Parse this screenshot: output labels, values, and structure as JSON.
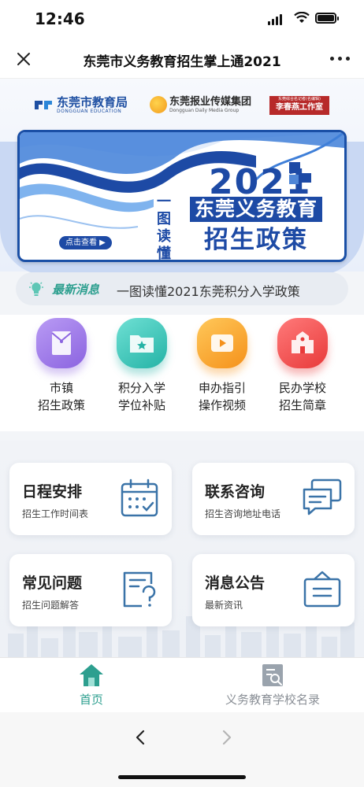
{
  "status_bar": {
    "time": "12:46"
  },
  "nav": {
    "title": "东莞市义务教育招生掌上通2021"
  },
  "logos": {
    "edu_bureau": "东莞市教育局",
    "edu_bureau_en": "DONGGUAN EDUCATION",
    "media_group": "东莞报业传媒集团",
    "media_group_en": "Dongguan Daily Media Group",
    "studio_top": "东莞综合名记者(名编辑)",
    "studio_name": "李春燕工作室"
  },
  "banner": {
    "year": "2021",
    "line1": "东莞义务教育",
    "line2": "招生政策",
    "vertical": "一图读懂",
    "button": "点击查看"
  },
  "ticker": {
    "label": "最新消息",
    "text": "一图读懂2021东莞积分入学政策"
  },
  "quick_links": [
    {
      "line1": "市镇",
      "line2": "招生政策",
      "icon": "envelope-icon",
      "color": "#9b73e6"
    },
    {
      "line1": "积分入学",
      "line2": "学位补贴",
      "icon": "folder-star-icon",
      "color": "#33c4b7"
    },
    {
      "line1": "申办指引",
      "line2": "操作视频",
      "icon": "play-video-icon",
      "color": "#f7a21b"
    },
    {
      "line1": "民办学校",
      "line2": "招生简章",
      "icon": "school-icon",
      "color": "#f04b4b"
    }
  ],
  "cards": [
    {
      "title": "日程安排",
      "subtitle": "招生工作时间表",
      "icon": "calendar-icon"
    },
    {
      "title": "联系咨询",
      "subtitle": "招生咨询地址电话",
      "icon": "chat-icon"
    },
    {
      "title": "常见问题",
      "subtitle": "招生问题解答",
      "icon": "faq-icon"
    },
    {
      "title": "消息公告",
      "subtitle": "最新资讯",
      "icon": "notice-board-icon"
    }
  ],
  "tabs": [
    {
      "label": "首页",
      "active": true,
      "icon": "home-icon"
    },
    {
      "label": "义务教育学校名录",
      "active": false,
      "icon": "directory-icon"
    }
  ],
  "colors": {
    "accent": "#2d9f8f",
    "banner_blue": "#1d4aa5",
    "icon_blue": "#3a73a8"
  }
}
